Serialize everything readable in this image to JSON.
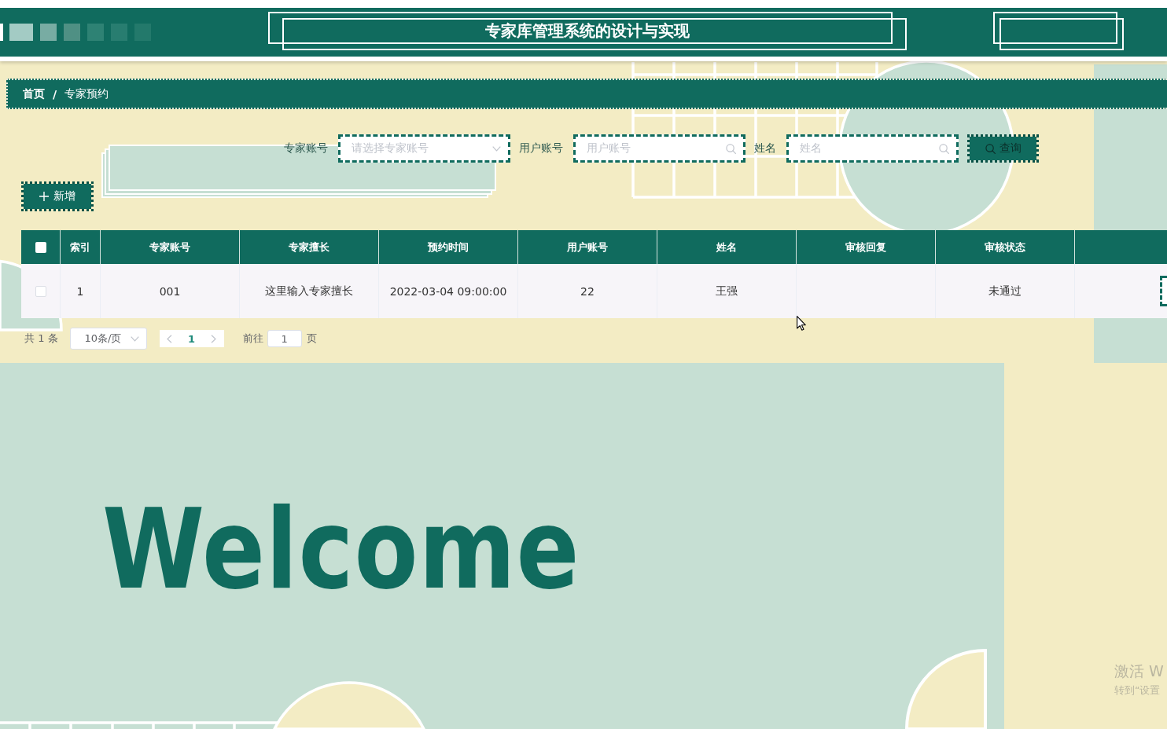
{
  "header": {
    "title": "专家库管理系统的设计与实现"
  },
  "breadcrumb": {
    "separator": "/",
    "items": [
      {
        "label": "首页",
        "current": false
      },
      {
        "label": "专家预约",
        "current": true
      }
    ]
  },
  "search": {
    "fields": [
      {
        "kind": "select",
        "label": "专家账号",
        "placeholder": "请选择专家账号"
      },
      {
        "kind": "input",
        "label": "用户账号",
        "placeholder": "用户账号"
      },
      {
        "kind": "input",
        "label": "姓名",
        "placeholder": "姓名"
      }
    ],
    "button": "查询"
  },
  "add_button": "新增",
  "table": {
    "select_all": {
      "checked": false
    },
    "columns": [
      "索引",
      "专家账号",
      "专家擅长",
      "预约时间",
      "用户账号",
      "姓名",
      "审核回复",
      "审核状态"
    ],
    "rows": [
      {
        "checked": false,
        "index": "1",
        "expert_account": "001",
        "expertise": "这里输入专家擅长",
        "appointment_time": "2022-03-04 09:00:00",
        "user_account": "22",
        "name": "王强",
        "review_status": "未通过",
        "has_action": true
      }
    ]
  },
  "pagination": {
    "total": "共 1 条",
    "page_size": "10条/页",
    "pages": [
      {
        "label": "1",
        "selected": true
      }
    ],
    "goto_label": "前往",
    "goto_value": "1",
    "goto_suffix": "页"
  },
  "welcome": "Welcome",
  "os_notice": {
    "title": "激活 W",
    "subtitle": "转到“设置"
  }
}
